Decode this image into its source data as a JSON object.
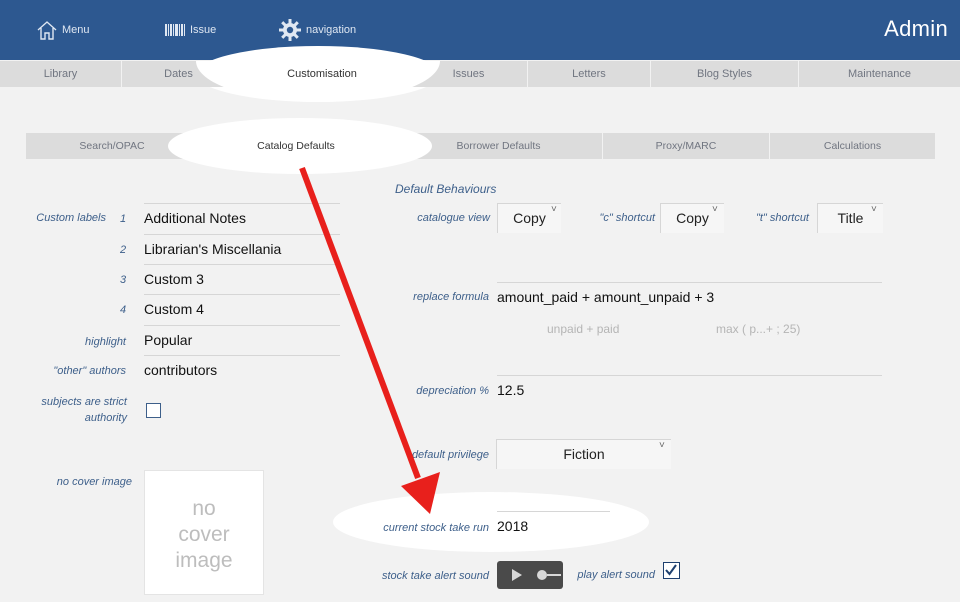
{
  "header": {
    "menu_label": "Menu",
    "issue_label": "Issue",
    "navigation_label": "navigation",
    "brand": "Admin",
    "icons": {
      "menu": "house-icon",
      "issue": "barcode-icon",
      "navigation": "gear-icon"
    }
  },
  "tabs": [
    {
      "label": "Library"
    },
    {
      "label": "Dates"
    },
    {
      "label": "Customisation"
    },
    {
      "label": "Issues"
    },
    {
      "label": "Letters"
    },
    {
      "label": "Blog Styles"
    },
    {
      "label": "Maintenance"
    }
  ],
  "subtabs": [
    {
      "label": "Search/OPAC"
    },
    {
      "label": "Catalog Defaults"
    },
    {
      "label": "Borrower Defaults"
    },
    {
      "label": "Proxy/MARC"
    },
    {
      "label": "Calculations"
    }
  ],
  "left": {
    "custom_labels_label": "Custom labels",
    "custom_labels": [
      {
        "num": "1",
        "value": "Additional Notes"
      },
      {
        "num": "2",
        "value": "Librarian's Miscellania"
      },
      {
        "num": "3",
        "value": "Custom 3"
      },
      {
        "num": "4",
        "value": "Custom 4"
      }
    ],
    "highlight_label": "highlight",
    "highlight_value": "Popular",
    "other_authors_label": "\"other\" authors",
    "other_authors_value": "contributors",
    "subjects_label_1": "subjects are strict",
    "subjects_label_2": "authority",
    "no_cover_label": "no cover image",
    "no_cover_text": [
      "no",
      "cover",
      "image"
    ]
  },
  "right": {
    "section_title": "Default Behaviours",
    "catalogue_view_label": "catalogue view",
    "catalogue_view_value": "Copy",
    "c_shortcut_label": "\"c\" shortcut",
    "c_shortcut_value": "Copy",
    "t_shortcut_label": "\"t\" shortcut",
    "t_shortcut_value": "Title",
    "replace_formula_label": "replace formula",
    "replace_formula_value": "amount_paid + amount_unpaid + 3",
    "formula_hint_1": "unpaid + paid",
    "formula_hint_2": "max ( p...+ ; 25)",
    "depreciation_label": "depreciation %",
    "depreciation_value": "12.5",
    "default_privilege_label": "default privilege",
    "default_privilege_value": "Fiction",
    "stock_take_label": "current stock take run",
    "stock_take_value": "2018",
    "alert_sound_label": "stock take alert sound",
    "play_alert_label": "play alert sound",
    "play_alert_checked": true
  },
  "colors": {
    "header_bg": "#2d5890",
    "label_blue": "#3d5f8a",
    "annotation_red": "#e8201c"
  }
}
